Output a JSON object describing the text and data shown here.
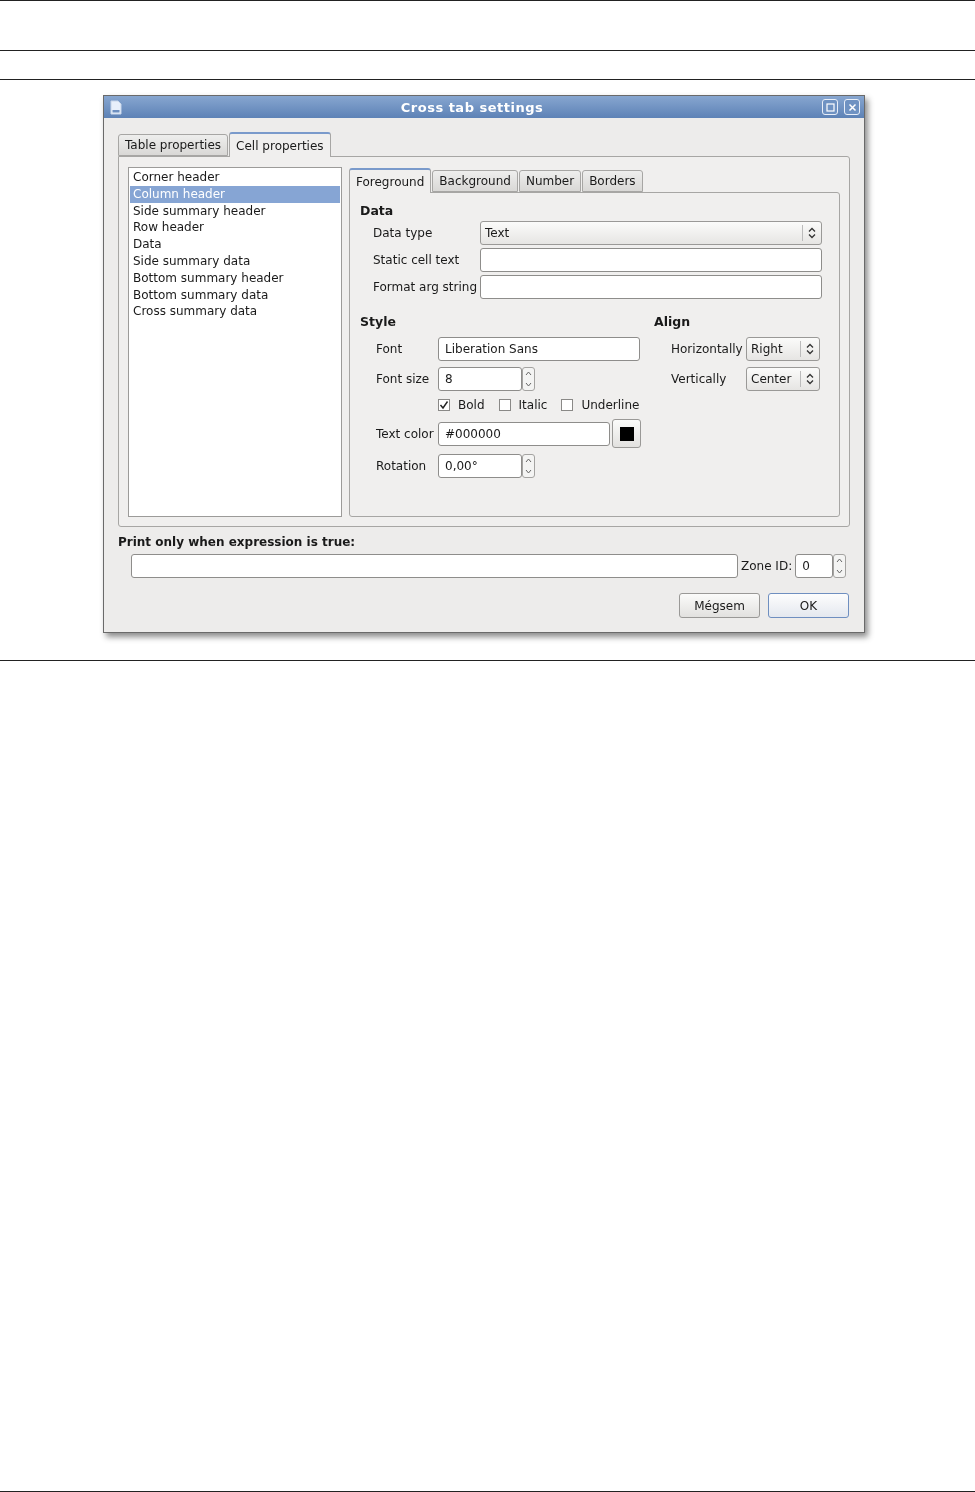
{
  "window": {
    "title": "Cross tab settings"
  },
  "tabs": [
    {
      "label": "Table properties",
      "selected": false
    },
    {
      "label": "Cell properties",
      "selected": true
    }
  ],
  "cell_list": {
    "items": [
      {
        "label": "Corner header",
        "selected": false
      },
      {
        "label": "Column header",
        "selected": true
      },
      {
        "label": "Side summary header",
        "selected": false
      },
      {
        "label": "Row header",
        "selected": false
      },
      {
        "label": "Data",
        "selected": false
      },
      {
        "label": "Side summary data",
        "selected": false
      },
      {
        "label": "Bottom summary header",
        "selected": false
      },
      {
        "label": "Bottom summary data",
        "selected": false
      },
      {
        "label": "Cross summary data",
        "selected": false
      }
    ]
  },
  "sub_tabs": [
    {
      "label": "Foreground",
      "selected": true
    },
    {
      "label": "Background",
      "selected": false
    },
    {
      "label": "Number",
      "selected": false
    },
    {
      "label": "Borders",
      "selected": false
    }
  ],
  "data_section": {
    "title": "Data",
    "data_type": {
      "label": "Data type",
      "value": "Text"
    },
    "static_cell_text": {
      "label": "Static cell text"
    },
    "format_arg_string": {
      "label": "Format arg string"
    }
  },
  "style_section": {
    "title": "Style",
    "font": {
      "label": "Font",
      "value": "Liberation Sans"
    },
    "font_size": {
      "label": "Font size",
      "value": "8"
    },
    "checkboxes": [
      {
        "label": "Bold",
        "checked": true
      },
      {
        "label": "Italic",
        "checked": false
      },
      {
        "label": "Underline",
        "checked": false
      }
    ],
    "text_color": {
      "label": "Text color",
      "value": "#000000",
      "color": "#000000"
    },
    "rotation": {
      "label": "Rotation",
      "value": "0,00°"
    }
  },
  "align_section": {
    "title": "Align",
    "horizontally": {
      "label": "Horizontally",
      "value": "Right"
    },
    "vertically": {
      "label": "Vertically",
      "value": "Center"
    }
  },
  "print_condition": {
    "label": "Print only when expression is true:"
  },
  "zone_id": {
    "label": "Zone ID:",
    "value": "0"
  },
  "buttons": [
    {
      "label": "Mégsem",
      "default": false
    },
    {
      "label": "OK",
      "default": true
    }
  ]
}
